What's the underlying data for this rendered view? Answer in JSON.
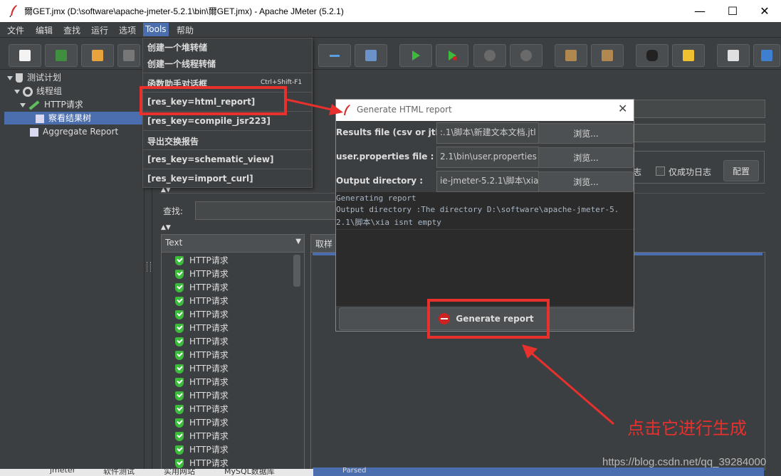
{
  "window": {
    "title": "爾GET.jmx (D:\\software\\apache-jmeter-5.2.1\\bin\\爾GET.jmx) - Apache JMeter (5.2.1)",
    "min": "—",
    "max": "☐",
    "close": "✕"
  },
  "menubar": [
    "文件",
    "编辑",
    "查找",
    "运行",
    "选项",
    "Tools",
    "帮助"
  ],
  "tools_menu": {
    "items": [
      {
        "label": "创建一个堆转储"
      },
      {
        "label": "创建一个线程转储"
      },
      {
        "label": "函数助手对话框",
        "shortcut": "Ctrl+Shift-F1"
      },
      {
        "label": "[res_key=html_report]"
      },
      {
        "label": "[res_key=compile_jsr223]"
      },
      {
        "label": "导出交换报告"
      },
      {
        "label": "[res_key=schematic_view]"
      },
      {
        "label": "[res_key=import_curl]"
      }
    ]
  },
  "tree": {
    "items": [
      "测试计划",
      "线程组",
      "HTTP请求",
      "察看结果树",
      "Aggregate Report"
    ]
  },
  "right_panel": {
    "log_only": "仅成功日志",
    "log_prefix": "志",
    "configure": "配置",
    "search_label": "查找:",
    "renderer": "Text",
    "tab_sampler": "取样",
    "results": [
      "HTTP请求",
      "HTTP请求",
      "HTTP请求",
      "HTTP请求",
      "HTTP请求",
      "HTTP请求",
      "HTTP请求",
      "HTTP请求",
      "HTTP请求",
      "HTTP请求",
      "HTTP请求",
      "HTTP请求",
      "HTTP请求",
      "HTTP请求",
      "HTTP请求",
      "HTTP请求"
    ],
    "bottom_tab": "Parsed"
  },
  "dialog": {
    "title": "Generate HTML report",
    "results_label": "Results file (csv or jtl) :",
    "results_value": ":.1\\脚本\\新建文本文档.jtl",
    "props_label": "user.properties file :",
    "props_value": "2.1\\bin\\user.properties",
    "output_label": "Output directory :",
    "output_value": "ie-jmeter-5.2.1\\脚本\\xia",
    "browse": "浏览...",
    "log_lines": [
      "Generating report",
      "Output directory :The directory D:\\software\\apache-jmeter-5.",
      "2.1\\脚本\\xia isnt empty"
    ],
    "generate": "Generate report"
  },
  "annotation": "点击它进行生成",
  "watermark": "https://blog.csdn.net/qq_39284000",
  "taskbar": [
    "jmeter",
    "软件测试",
    "实用网站",
    "MySQL数据库"
  ],
  "colors": {
    "accent": "#4b6eaf",
    "annotation": "#e8302d",
    "ok": "#3dbb3d",
    "stop": "#cc2222"
  }
}
